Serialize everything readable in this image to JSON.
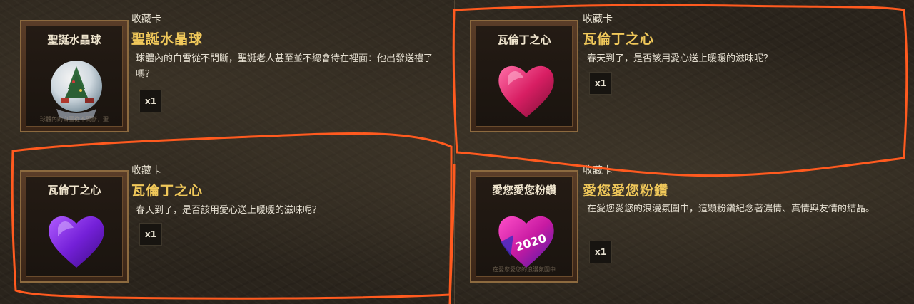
{
  "cards": [
    {
      "category": "收藏卡",
      "name": "聖誕水晶球",
      "thumb_title": "聖誕水晶球",
      "thumb_caption": "球體內的白雪從不間斷，聖",
      "description": "球體內的白雪從不間斷，聖誕老人甚至並不總會待在裡面：他出發送禮了嗎？",
      "quantity": "x1",
      "icon": "snow-globe-icon"
    },
    {
      "category": "收藏卡",
      "name": "瓦倫丁之心",
      "thumb_title": "瓦倫丁之心",
      "thumb_caption": "",
      "description": "春天到了，是否該用愛心送上暖暖的滋味呢？",
      "quantity": "x1",
      "icon": "pink-heart-icon"
    },
    {
      "category": "收藏卡",
      "name": "瓦倫丁之心",
      "thumb_title": "瓦倫丁之心",
      "thumb_caption": "",
      "description": "春天到了，是否該用愛心送上暖暖的滋味呢？",
      "quantity": "x1",
      "icon": "purple-heart-icon"
    },
    {
      "category": "收藏卡",
      "name": "愛您愛您粉鑽",
      "thumb_title": "愛您愛您粉鑽",
      "thumb_caption": "在愛您愛您的浪漫氛圍中",
      "description": "在愛您愛您的浪漫氛圍中，這顆粉鑽紀念著濃情、真情與友情的結晶。",
      "quantity": "x1",
      "art_text": "2020",
      "icon": "pink-diamond-icon"
    }
  ],
  "colors": {
    "name": "#f0c85a",
    "annotation": "#ff5a1f"
  }
}
